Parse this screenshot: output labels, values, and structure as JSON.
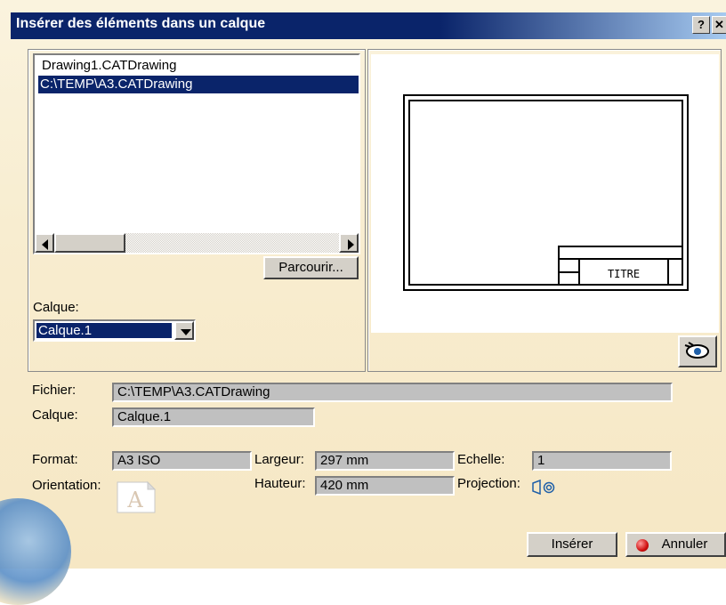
{
  "dialog": {
    "title": "Insérer des éléments dans un calque",
    "help_btn": "?",
    "close_btn": "✕"
  },
  "files": {
    "items": [
      "Drawing1.CATDrawing",
      "C:\\TEMP\\A3.CATDrawing"
    ],
    "selected_index": 1
  },
  "browse_button": "Parcourir...",
  "calque_select": {
    "label": "Calque:",
    "value": "Calque.1"
  },
  "preview": {
    "title_block_text": "TITRE",
    "eye_icon": "eye-icon"
  },
  "info": {
    "fichier_label": "Fichier:",
    "fichier_value": "C:\\TEMP\\A3.CATDrawing",
    "calque_label": "Calque:",
    "calque_value": "Calque.1",
    "format_label": "Format:",
    "format_value": "A3 ISO",
    "largeur_label": "Largeur:",
    "largeur_value": "297 mm",
    "echelle_label": "Echelle:",
    "echelle_value": "1",
    "orientation_label": "Orientation:",
    "orientation_icon": "A",
    "hauteur_label": "Hauteur:",
    "hauteur_value": "420 mm",
    "projection_label": "Projection:"
  },
  "buttons": {
    "insert": "Insérer",
    "cancel": "Annuler"
  },
  "colors": {
    "title_bar": "#0a246a",
    "selection": "#0a246a",
    "dialog_bg": "#f8edd0",
    "field_bg": "#c0c0c0"
  }
}
